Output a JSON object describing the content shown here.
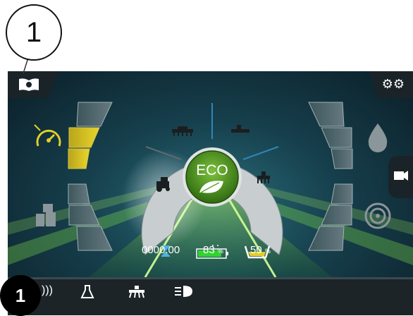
{
  "callouts": {
    "top_number": "1",
    "bottom_number": "1"
  },
  "center": {
    "mode_label": "ECO"
  },
  "status": {
    "hours_value": "0000.00",
    "battery_value": "83",
    "battery_unit": "%",
    "tank_value": "50",
    "tank_unit": "%"
  },
  "levels": {
    "speed_segments_lit": 2,
    "speed_segments_total": 3
  },
  "colors": {
    "eco_green": "#4f9a1f",
    "highlight_yellow": "#e3cf2a",
    "accent_blue": "#2f86b9"
  },
  "icons": {
    "top_left": "manual-icon",
    "top_right": "settings-gears-icon",
    "left_upper": "speed-gauge-icon",
    "left_lower": "implement-weights-icon",
    "right_upper": "liquid-drop-icon",
    "right_lower": "target-icon",
    "right_tab": "camera-icon",
    "bottom": [
      "sound-icon",
      "flask-icon",
      "spreader-icon",
      "headlight-icon"
    ]
  }
}
